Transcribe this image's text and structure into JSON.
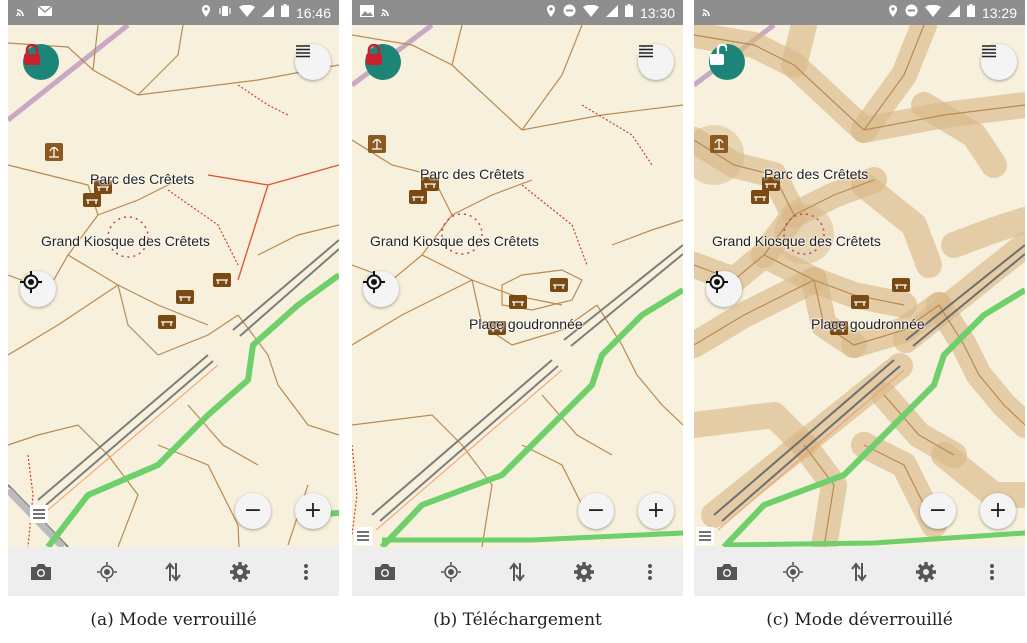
{
  "colors": {
    "map_background": "#f7f0dc",
    "lock_button": "#1c8578",
    "lock_icon_locked": "#c8202e",
    "lock_icon_unlocked": "#ffffff",
    "green_route": "#6fcf6b",
    "dashed_path": "#b98a52",
    "red_path": "#e0502a",
    "railway": "#7d7d7d",
    "status_bar": "#8e8e8e",
    "bottom_bar": "#eeeeee",
    "bench_icon": "#7a4a14",
    "highlight_overlay": "#d8b888"
  },
  "screens": [
    {
      "status": {
        "time": "16:46",
        "left_icons": [
          "cast-icon",
          "mail-icon"
        ],
        "right_icons": [
          "location-pin-icon",
          "vibrate-icon",
          "wifi-icon",
          "signal-icon",
          "battery-icon"
        ]
      },
      "lock_state": "locked",
      "lock_icon": "padlock-closed-icon",
      "labels": {
        "park": "Parc des Crêtets",
        "kiosk": "Grand Kiosque des Crêtets",
        "square": ""
      },
      "zoom": {
        "minus": "−",
        "plus": "+"
      },
      "toolbar": [
        "camera-icon",
        "gps-icon",
        "transfer-arrows-icon",
        "settings-icon",
        "more-vert-icon"
      ],
      "caption": "(a) Mode verrouillé"
    },
    {
      "status": {
        "time": "13:30",
        "left_icons": [
          "image-icon",
          "cast-icon"
        ],
        "right_icons": [
          "location-pin-icon",
          "do-not-disturb-icon",
          "wifi-icon",
          "signal-icon",
          "battery-icon"
        ]
      },
      "lock_state": "locked",
      "lock_icon": "padlock-closed-icon",
      "labels": {
        "park": "Parc des Crêtets",
        "kiosk": "Grand Kiosque des Crêtets",
        "square": "Place goudronnée"
      },
      "zoom": {
        "minus": "−",
        "plus": "+"
      },
      "toolbar": [
        "camera-icon",
        "gps-icon",
        "transfer-arrows-icon",
        "settings-icon",
        "more-vert-icon"
      ],
      "caption": "(b) Téléchargement"
    },
    {
      "status": {
        "time": "13:29",
        "left_icons": [
          "cast-icon"
        ],
        "right_icons": [
          "location-pin-icon",
          "do-not-disturb-icon",
          "wifi-icon",
          "signal-icon",
          "battery-icon"
        ]
      },
      "lock_state": "unlocked",
      "lock_icon": "padlock-open-icon",
      "labels": {
        "park": "Parc des Crêtets",
        "kiosk": "Grand Kiosque des Crêtets",
        "square": "Place goudronnée"
      },
      "zoom": {
        "minus": "−",
        "plus": "+"
      },
      "toolbar": [
        "camera-icon",
        "gps-icon",
        "transfer-arrows-icon",
        "settings-icon",
        "more-vert-icon"
      ],
      "caption": "(c) Mode déverrouillé"
    }
  ]
}
